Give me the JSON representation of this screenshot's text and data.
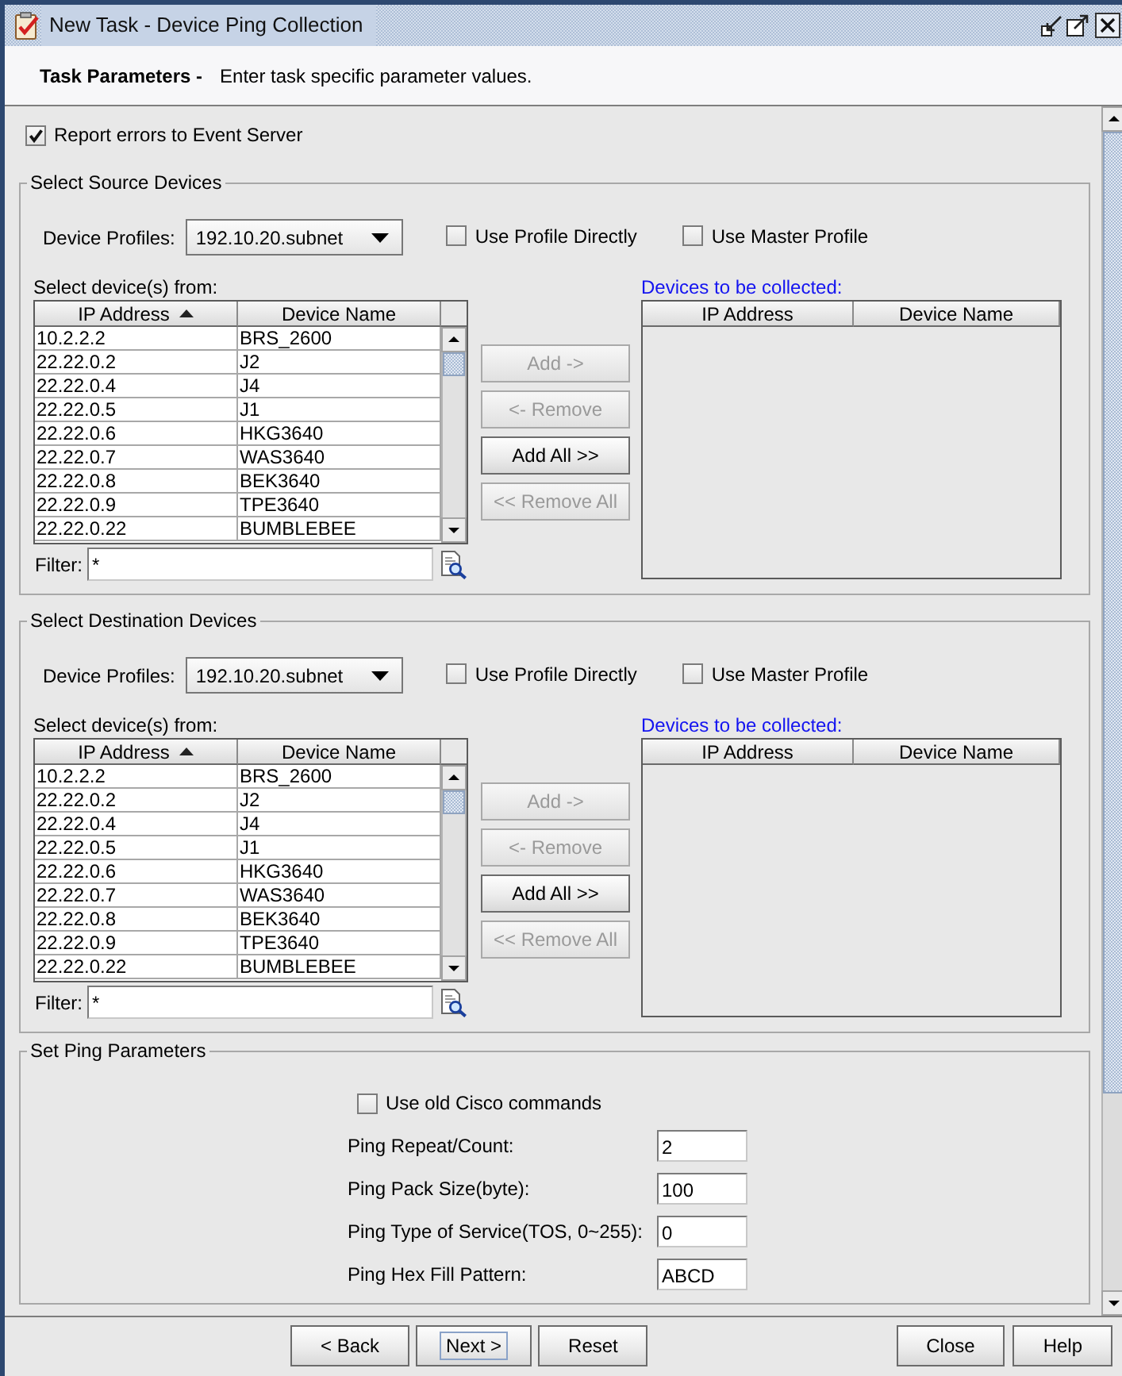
{
  "window": {
    "title": "New Task - Device Ping Collection"
  },
  "header": {
    "title": "Task Parameters -",
    "description": "Enter task specific parameter values."
  },
  "report_errors": {
    "label": "Report errors to Event Server",
    "checked": true
  },
  "device_sections": [
    {
      "title": "Select Source Devices",
      "profile_label": "Device Profiles:",
      "profile_value": "192.10.20.subnet",
      "options": [
        {
          "label": "Use Profile Directly",
          "checked": false
        },
        {
          "label": "Use Master Profile",
          "checked": false
        }
      ],
      "available": {
        "label": "Select device(s) from:",
        "columns": [
          {
            "label": "IP Address",
            "sorted": true
          },
          {
            "label": "Device Name",
            "sorted": false
          }
        ],
        "rows": [
          [
            "10.2.2.2",
            "BRS_2600"
          ],
          [
            "22.22.0.2",
            "J2"
          ],
          [
            "22.22.0.4",
            "J4"
          ],
          [
            "22.22.0.5",
            "J1"
          ],
          [
            "22.22.0.6",
            "HKG3640"
          ],
          [
            "22.22.0.7",
            "WAS3640"
          ],
          [
            "22.22.0.8",
            "BEK3640"
          ],
          [
            "22.22.0.9",
            "TPE3640"
          ],
          [
            "22.22.0.22",
            "BUMBLEBEE"
          ]
        ]
      },
      "filter": {
        "label": "Filter:",
        "value": "*"
      },
      "buttons": [
        {
          "label": "Add ->",
          "disabled": true
        },
        {
          "label": "<- Remove",
          "disabled": true
        },
        {
          "label": "Add All >>",
          "disabled": false
        },
        {
          "label": "<< Remove All",
          "disabled": true
        }
      ],
      "collected": {
        "label": "Devices to be collected:",
        "columns": [
          "IP Address",
          "Device Name"
        ]
      }
    },
    {
      "title": "Select Destination Devices",
      "profile_label": "Device Profiles:",
      "profile_value": "192.10.20.subnet",
      "options": [
        {
          "label": "Use Profile Directly",
          "checked": false
        },
        {
          "label": "Use Master Profile",
          "checked": false
        }
      ],
      "available": {
        "label": "Select device(s) from:",
        "columns": [
          {
            "label": "IP Address",
            "sorted": true
          },
          {
            "label": "Device Name",
            "sorted": false
          }
        ],
        "rows": [
          [
            "10.2.2.2",
            "BRS_2600"
          ],
          [
            "22.22.0.2",
            "J2"
          ],
          [
            "22.22.0.4",
            "J4"
          ],
          [
            "22.22.0.5",
            "J1"
          ],
          [
            "22.22.0.6",
            "HKG3640"
          ],
          [
            "22.22.0.7",
            "WAS3640"
          ],
          [
            "22.22.0.8",
            "BEK3640"
          ],
          [
            "22.22.0.9",
            "TPE3640"
          ],
          [
            "22.22.0.22",
            "BUMBLEBEE"
          ]
        ]
      },
      "filter": {
        "label": "Filter:",
        "value": "*"
      },
      "buttons": [
        {
          "label": "Add ->",
          "disabled": true
        },
        {
          "label": "<- Remove",
          "disabled": true
        },
        {
          "label": "Add All >>",
          "disabled": false
        },
        {
          "label": "<< Remove All",
          "disabled": true
        }
      ],
      "collected": {
        "label": "Devices to be collected:",
        "columns": [
          "IP Address",
          "Device Name"
        ]
      }
    }
  ],
  "ping_parameters": {
    "title": "Set Ping Parameters",
    "old_cisco": {
      "label": "Use old Cisco commands",
      "checked": false
    },
    "fields": [
      {
        "label": "Ping Repeat/Count:",
        "value": "2"
      },
      {
        "label": "Ping Pack Size(byte):",
        "value": "100"
      },
      {
        "label": "Ping Type of Service(TOS, 0~255):",
        "value": "0"
      },
      {
        "label": "Ping Hex Fill Pattern:",
        "value": "ABCD"
      }
    ]
  },
  "footer": {
    "nav_buttons": [
      {
        "label": "< Back",
        "focused": false
      },
      {
        "label": "Next >",
        "focused": true
      },
      {
        "label": "Reset",
        "focused": false
      }
    ],
    "dialog_buttons": [
      {
        "label": "Close",
        "focused": false
      },
      {
        "label": "Help",
        "focused": false
      }
    ]
  }
}
